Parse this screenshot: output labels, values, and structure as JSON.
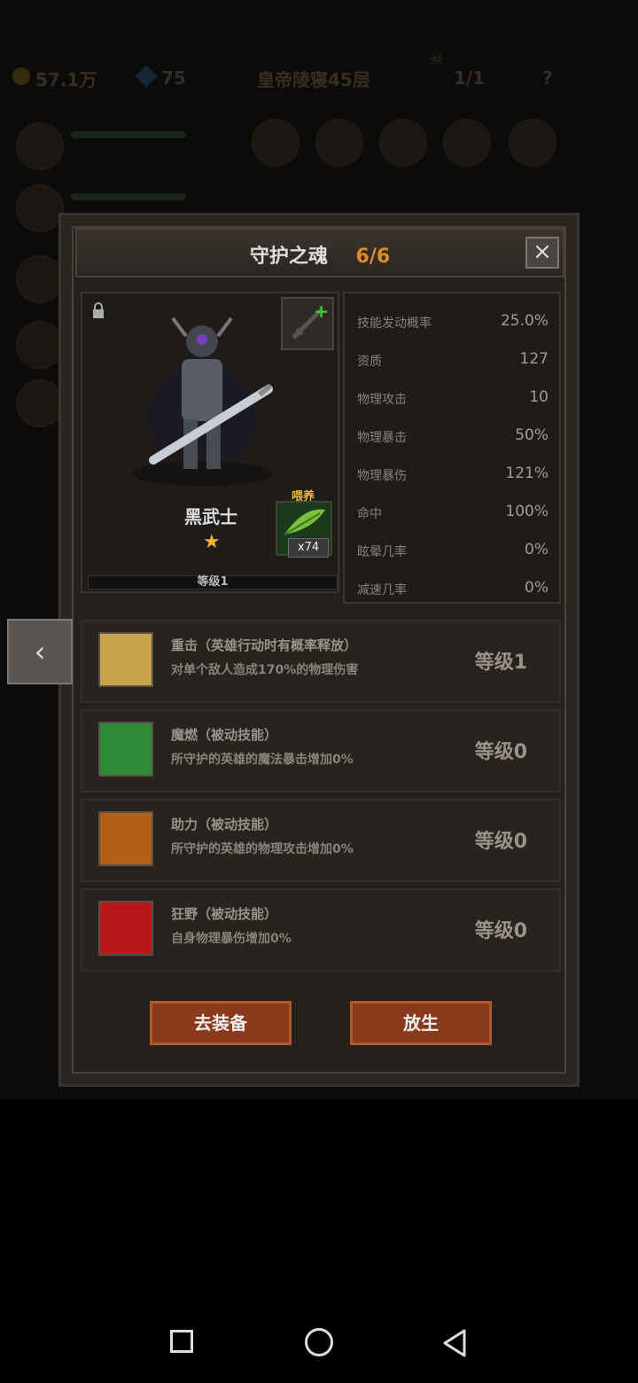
{
  "hud": {
    "gold": "57.1万",
    "gems": "75",
    "stage": "皇帝陵寝45层",
    "boss_count": "1/1",
    "help": "?"
  },
  "dialog": {
    "title": "守护之魂",
    "count": "6/6",
    "close_symbol": "×"
  },
  "hero": {
    "name": "黑武士",
    "star": "★",
    "feed_label": "喂养",
    "feed_count": "x74",
    "level": "等级1",
    "plus": "+"
  },
  "stats": [
    {
      "name": "技能发动概率",
      "value": "25.0%"
    },
    {
      "name": "资质",
      "value": "127"
    },
    {
      "name": "物理攻击",
      "value": "10"
    },
    {
      "name": "物理暴击",
      "value": "50%"
    },
    {
      "name": "物理暴伤",
      "value": "121%"
    },
    {
      "name": "命中",
      "value": "100%"
    },
    {
      "name": "眩晕几率",
      "value": "0%"
    },
    {
      "name": "减速几率",
      "value": "0%"
    }
  ],
  "skills": [
    {
      "title": "重击（英雄行动时有概率释放）",
      "desc": "对单个敌人造成170%的物理伤害",
      "level": "等级1",
      "color": "#c9a24a"
    },
    {
      "title": "魔燃（被动技能）",
      "desc": "所守护的英雄的魔法暴击增加0%",
      "level": "等级0",
      "color": "#2f8a3a"
    },
    {
      "title": "助力（被动技能）",
      "desc": "所守护的英雄的物理攻击增加0%",
      "level": "等级0",
      "color": "#b06018"
    },
    {
      "title": "狂野（被动技能）",
      "desc": "自身物理暴伤增加0%",
      "level": "等级0",
      "color": "#b81818"
    }
  ],
  "buttons": {
    "equip": "去装备",
    "release": "放生"
  },
  "back_symbol": "‹"
}
